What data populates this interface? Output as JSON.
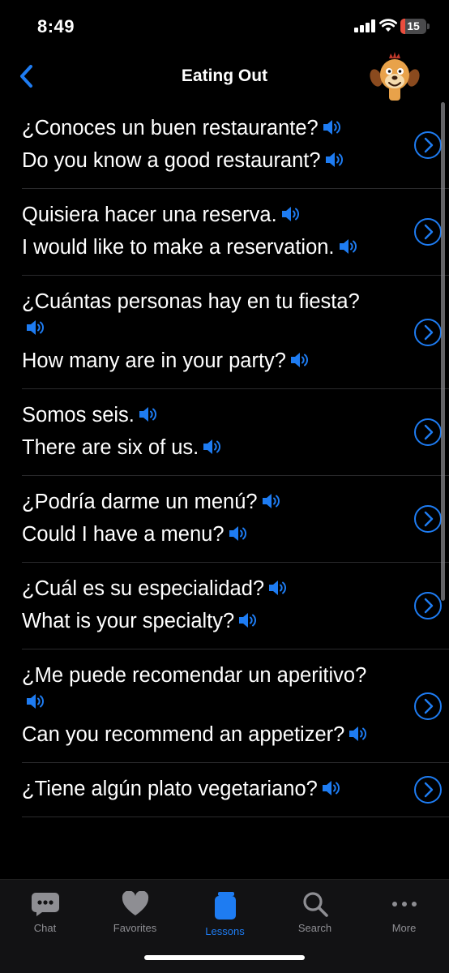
{
  "status": {
    "time": "8:49",
    "battery": "15"
  },
  "nav": {
    "title": "Eating Out",
    "back_icon": "chevron-left-icon",
    "mascot": "mascot-avatar"
  },
  "phrases": [
    {
      "spanish": "¿Conoces un buen restaurante?",
      "english": "Do you know a good restaurant?"
    },
    {
      "spanish": "Quisiera hacer una reserva.",
      "english": "I would like to make a reservation."
    },
    {
      "spanish": "¿Cuántas personas hay en tu fiesta?",
      "english": "How many are in your party?"
    },
    {
      "spanish": "Somos seis.",
      "english": "There are six of us."
    },
    {
      "spanish": "¿Podría darme un menú?",
      "english": "Could I have a menu?"
    },
    {
      "spanish": "¿Cuál es su especialidad?",
      "english": "What is your specialty?"
    },
    {
      "spanish": "¿Me puede recomendar un aperitivo?",
      "english": "Can you recommend an appetizer?"
    },
    {
      "spanish": "¿Tiene algún plato vegetariano?",
      "english": ""
    }
  ],
  "tabs": [
    {
      "label": "Chat",
      "icon": "chat-bubble-icon",
      "active": false
    },
    {
      "label": "Favorites",
      "icon": "heart-icon",
      "active": false
    },
    {
      "label": "Lessons",
      "icon": "book-icon",
      "active": true
    },
    {
      "label": "Search",
      "icon": "search-icon",
      "active": false
    },
    {
      "label": "More",
      "icon": "more-dots-icon",
      "active": false
    }
  ],
  "colors": {
    "accent": "#1e7cf2",
    "background": "#000000",
    "separator": "#2a2a2c",
    "inactive": "#8e8e93"
  }
}
